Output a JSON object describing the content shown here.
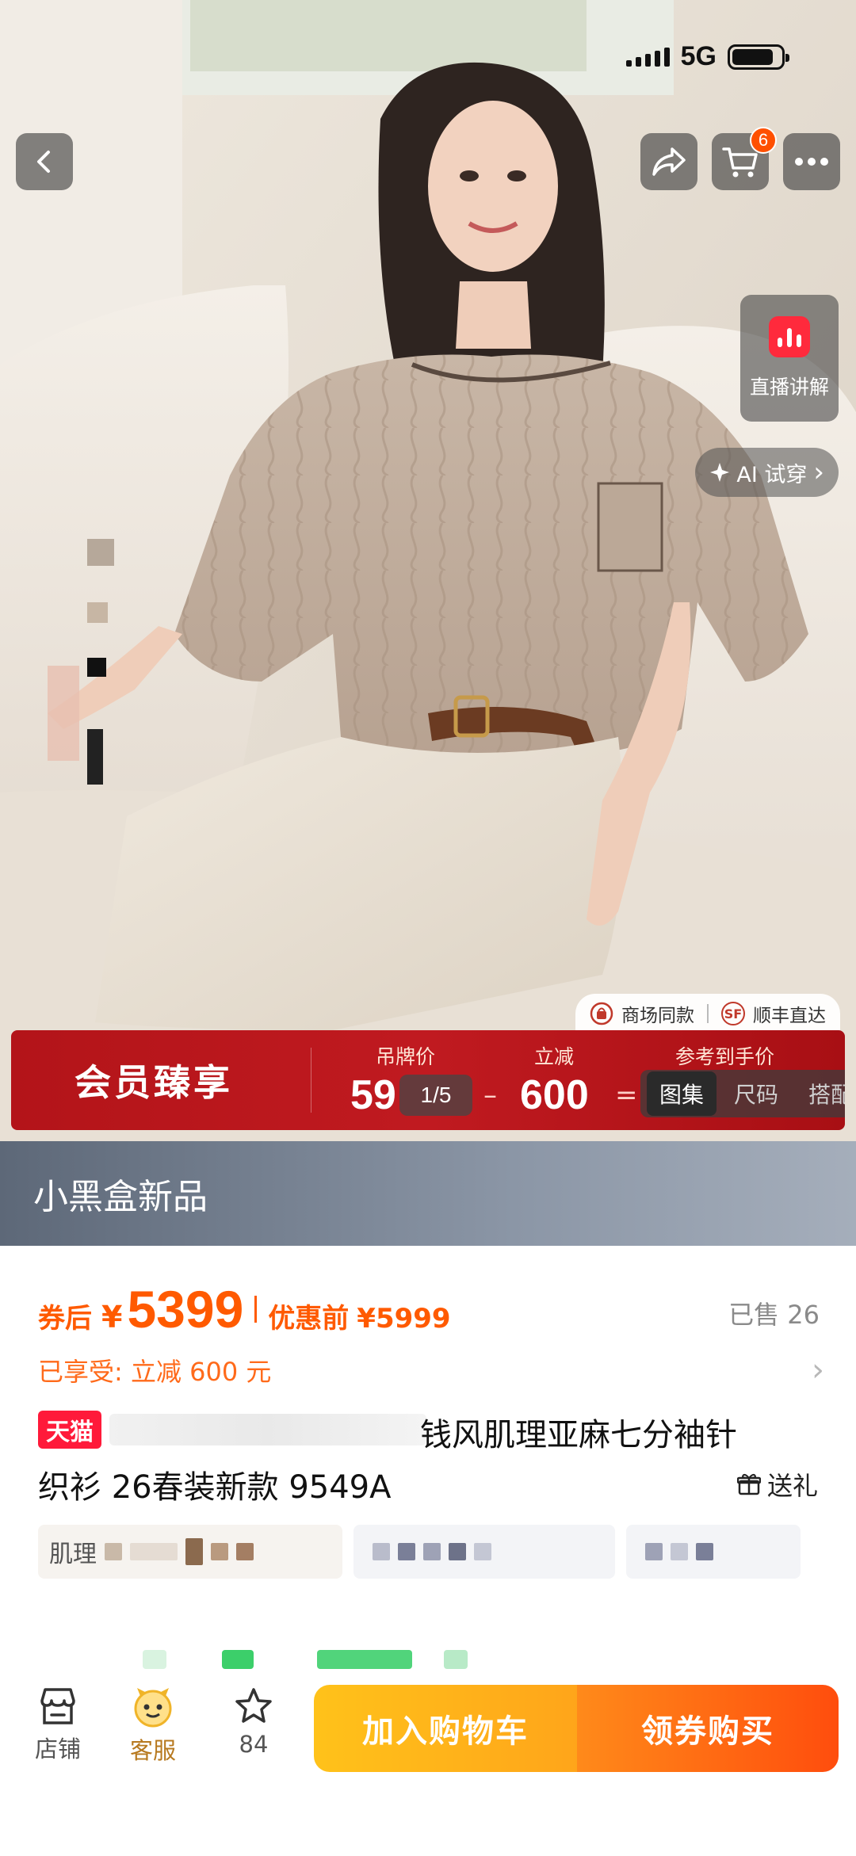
{
  "status_bar": {
    "network": "5G",
    "battery_level": 0.85
  },
  "nav": {
    "cart_count": "6"
  },
  "hero": {
    "live_label": "直播讲解",
    "ai_try_label": "AI 试穿",
    "ai_try_arrow": "›",
    "mall_tags": [
      "商场同款",
      "顺丰直达"
    ],
    "sf_icon_text": "SF"
  },
  "member_bar": {
    "title": "会员臻享",
    "tag_price_label": "吊牌价",
    "tag_price_value": "59",
    "discount_label": "立减",
    "discount_value": "600",
    "minus": "–",
    "equals": "=",
    "final_label": "参考到手价",
    "pager": "1/5",
    "gallery_tabs": [
      "图集",
      "尺码",
      "搭配"
    ]
  },
  "store": {
    "name": "小黑盒新品"
  },
  "price": {
    "after_coupon_label": "券后",
    "currency": "¥",
    "after_coupon_value": "5399",
    "before_label": "优惠前",
    "before_value": "¥5999",
    "sold": "已售 26",
    "enjoyed": "已享受: 立减 600 元",
    "arrow": "›"
  },
  "product": {
    "tmall_tag": "天猫",
    "title_part1": "钱风肌理亚麻七分袖针",
    "title_part2": "织衫 26春装新款 9549A",
    "gift_label": "送礼",
    "chips": [
      "肌理",
      "",
      ""
    ]
  },
  "bottom_bar": {
    "store_label": "店铺",
    "service_label": "客服",
    "fav_count": "84",
    "add_cart": "加入购物车",
    "buy": "领券购买"
  },
  "colors": {
    "accent": "#ff5000",
    "member_red": "#b31419",
    "tmall_red": "#ff1a3a"
  }
}
